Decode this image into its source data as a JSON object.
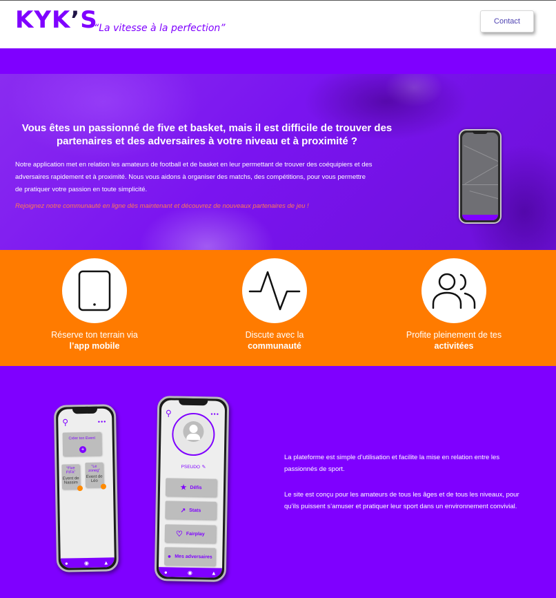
{
  "header": {
    "logo_main": "KYK",
    "logo_apostrophe": "’",
    "logo_s": "S",
    "tagline": "“La vitesse à la perfection”",
    "contact_label": "Contact"
  },
  "hero": {
    "title": "Vous êtes un passionné de five et basket, mais il est difficile de trouver des partenaires et des adversaires à votre niveau et à proximité ?",
    "text": "Notre application met en relation les amateurs de football et de basket en leur permettant de trouver des coéquipiers et des adversaires rapidement et à proximité. Nous vous aidons à organiser des matchs, des compétitions, pour vous permettre de pratiquer votre passion en toute simplicité.",
    "cta": "Rejoignez notre communauté en ligne dès maintenant et découvrez de nouveaux partenaires de jeu !"
  },
  "features": [
    {
      "icon": "smartphone-icon",
      "line1": "Réserve ton terrain via",
      "line2": "l’app mobile"
    },
    {
      "icon": "pulse-icon",
      "line1": "Discute avec la",
      "line2": "communauté"
    },
    {
      "icon": "users-icon",
      "line1": "Profite pleinement de tes",
      "line2": "activitées"
    }
  ],
  "phone_left": {
    "create_event": "Créer ton Event",
    "event1_title": "“Five FIFA”",
    "event1_text": "Event de Nassim",
    "event2_title": "“Le zoneg”",
    "event2_text": "Event de Léo"
  },
  "phone_right": {
    "pseudo": "PSEUDO",
    "buttons": [
      "Défis",
      "Stats",
      "Fairplay",
      "Mes adversaires"
    ]
  },
  "bottom": {
    "para1": "La plateforme est simple d’utilisation et facilite la mise en relation entre les passionnés de sport.",
    "para2": "Le site est conçu pour les amateurs de tous les âges et de tous les niveaux, pour qu’ils puissent s’amuser et pratiquer leur sport dans un environnement convivial."
  },
  "colors": {
    "primary": "#7f00ff",
    "orange": "#ff7b00",
    "cta": "#ff7a54"
  }
}
